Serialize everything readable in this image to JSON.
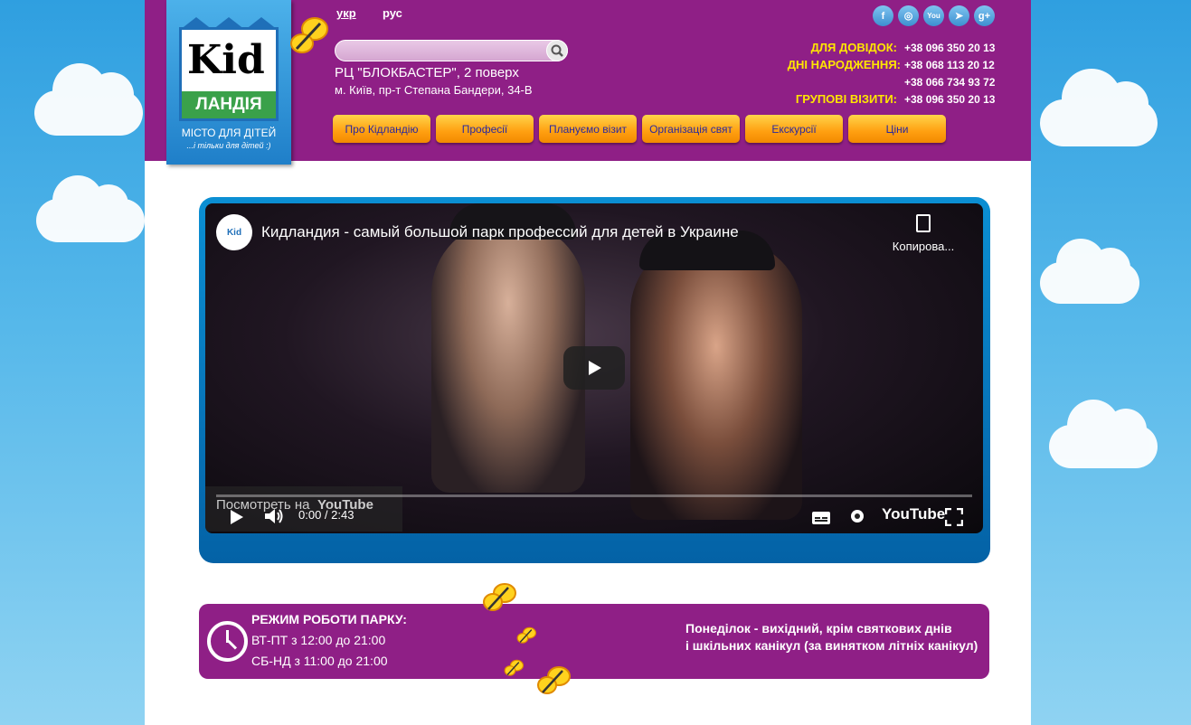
{
  "logo": {
    "kid": "Kid",
    "landia": "ЛАНДІЯ",
    "tagline": "МІСТО ДЛЯ ДІТЕЙ",
    "subtagline": "...і тільки для дітей :)"
  },
  "languages": [
    {
      "label": "укр",
      "active": true
    },
    {
      "label": "рус",
      "active": false
    }
  ],
  "search": {
    "placeholder": ""
  },
  "address": {
    "line1": "РЦ \"БЛОКБАСТЕР\", 2 поверх",
    "line2": "м. Київ, пр-т Степана Бандери, 34-В"
  },
  "social": [
    {
      "icon": "facebook-icon",
      "glyph": "f"
    },
    {
      "icon": "instagram-icon",
      "glyph": "◎"
    },
    {
      "icon": "youtube-icon",
      "glyph": "You"
    },
    {
      "icon": "telegram-icon",
      "glyph": "➤"
    },
    {
      "icon": "googleplus-icon",
      "glyph": "g+"
    }
  ],
  "contacts": {
    "info_label": "ДЛЯ ДОВІДОК:",
    "info_phone": "+38 096 350 20 13",
    "birthday_label": "ДНІ НАРОДЖЕННЯ:",
    "birthday_phone1": "+38 068 113 20 12",
    "birthday_phone2": "+38 066 734 93 72",
    "group_label": "ГРУПОВІ ВІЗИТИ:",
    "group_phone": "+38 096 350 20 13"
  },
  "nav": [
    "Про Кідландію",
    "Професії",
    "Плануємо візит",
    "Організація свят",
    "Екскурсії",
    "Ціни"
  ],
  "video": {
    "channel_logo": "Kid",
    "title": "Кидландия - самый большой парк профессий для детей в Украине",
    "copy_label": "Копирова...",
    "watch_on": "Посмотреть на",
    "watch_brand": "YouTube",
    "time": "0:00 / 2:43",
    "brand": "YouTube"
  },
  "hours": {
    "title": "РЕЖИМ РОБОТИ ПАРКУ:",
    "weekdays": "ВТ-ПТ з 12:00 до 21:00",
    "weekend": "СБ-НД з 11:00 до 21:00",
    "note_line1": "Понеділок - вихідний, крім святкових днів",
    "note_line2": "і шкільних канікул (за винятком літніх канікул)"
  },
  "colors": {
    "header": "#8f1f86",
    "accent_yellow": "#ffe600",
    "nav_button": "#ff9f10",
    "video_frame": "#0b8fd3"
  }
}
